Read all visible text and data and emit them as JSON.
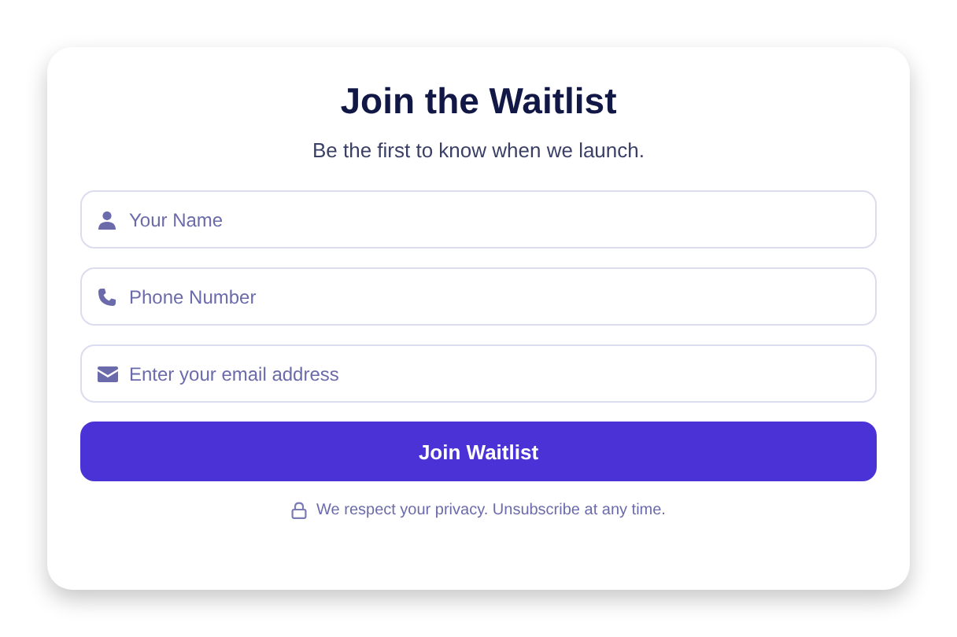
{
  "title": "Join the Waitlist",
  "subtitle": "Be the first to know when we launch.",
  "fields": [
    {
      "kind": "person",
      "placeholder": "Your Name"
    },
    {
      "kind": "phone",
      "placeholder": "Phone Number"
    },
    {
      "kind": "mail",
      "placeholder": "Enter your email address"
    }
  ],
  "submit_button": "Join Waitlist",
  "privacy_note": "We respect your privacy. Unsubscribe at any time."
}
